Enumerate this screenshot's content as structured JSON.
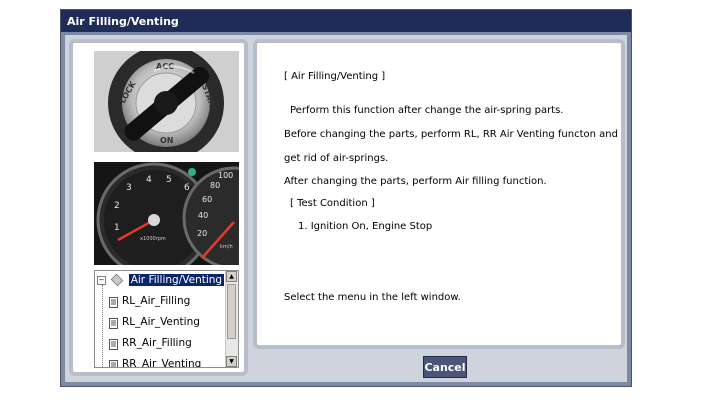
{
  "window": {
    "title": "Air Filling/Venting"
  },
  "images": {
    "ignition_key": {
      "labels": [
        "LOCK",
        "ACC",
        "START",
        "ON"
      ]
    },
    "gauge_cluster": {
      "tach_numbers": [
        "1",
        "2",
        "3",
        "4",
        "5",
        "6"
      ],
      "tach_unit": "x1000rpm",
      "speed_numbers": [
        "20",
        "40",
        "60",
        "80",
        "100"
      ],
      "speed_unit": "km/h"
    }
  },
  "tree": {
    "root": "Air Filling/Venting",
    "items": [
      "RL_Air_Filling",
      "RL_Air_Venting",
      "RR_Air_Filling",
      "RR_Air_Venting"
    ]
  },
  "content": {
    "heading": "[ Air Filling/Venting ]",
    "line1": "Perform this function after change the air-spring parts.",
    "line2": "Before changing the parts, perform RL, RR Air Venting functon and",
    "line3": "get rid of air-springs.",
    "line4": "After changing the parts, perform Air filling function.",
    "condition_heading": "[ Test Condition ]",
    "condition_1": "1. Ignition On, Engine Stop",
    "footer": "Select the menu in the left window."
  },
  "buttons": {
    "cancel": "Cancel"
  }
}
